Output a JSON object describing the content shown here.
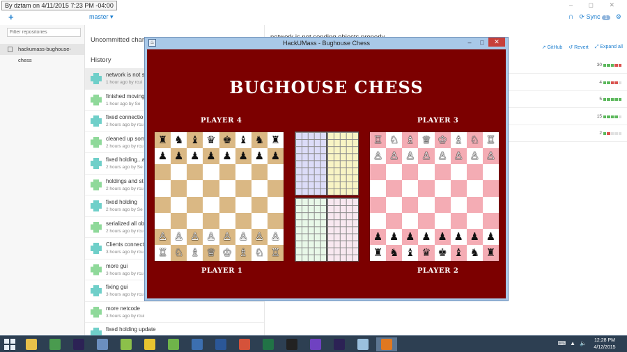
{
  "caption": "By dztam on 4/11/2015 7:23 PM -04:00",
  "github": {
    "add_label": "+",
    "branch": "master ▾",
    "window_controls": "– ◻ ✕",
    "sync_label": "Sync",
    "sync_count": "1",
    "filter_placeholder": "Filter repositories",
    "repo_name": "hackumass-bughouse-chess",
    "uncommitted_label": "Uncommitted changes",
    "history_label": "History",
    "commit_title": "network is not sending objects properly",
    "actions": [
      "GitHub",
      "Revert",
      "Expand all"
    ],
    "commits": [
      {
        "msg": "network is not s",
        "meta": "1 hour ago by rcui"
      },
      {
        "msg": "finished moving",
        "meta": "1 hour ago by Se"
      },
      {
        "msg": "fixed connectio",
        "meta": "2 hours ago by rcu"
      },
      {
        "msg": "cleaned up som",
        "meta": "2 hours ago by rcu"
      },
      {
        "msg": "fixed holding...a",
        "meta": "2 hours ago by Se"
      },
      {
        "msg": "holdings and st",
        "meta": "2 hours ago by rcu"
      },
      {
        "msg": "fixed holding",
        "meta": "2 hours ago by Se"
      },
      {
        "msg": "serialized all ob",
        "meta": "2 hours ago by rcu"
      },
      {
        "msg": "Clients connect",
        "meta": "3 hours ago by rcu"
      },
      {
        "msg": "more gui",
        "meta": "3 hours ago by rcu"
      },
      {
        "msg": "fixing gui",
        "meta": "3 hours ago by rcu"
      },
      {
        "msg": "more netcode",
        "meta": "3 hours ago by rcui"
      },
      {
        "msg": "fixed holding update",
        "meta": ""
      }
    ],
    "files": [
      {
        "count": "30",
        "colors": [
          "#5cb85c",
          "#5cb85c",
          "#5cb85c",
          "#d9534f",
          "#d9534f"
        ]
      },
      {
        "count": "4",
        "colors": [
          "#5cb85c",
          "#5cb85c",
          "#d9534f",
          "#d9534f",
          "#e0e0e0"
        ]
      },
      {
        "count": "5",
        "colors": [
          "#5cb85c",
          "#5cb85c",
          "#5cb85c",
          "#5cb85c",
          "#5cb85c"
        ]
      },
      {
        "count": "15",
        "colors": [
          "#5cb85c",
          "#5cb85c",
          "#5cb85c",
          "#5cb85c",
          "#e0e0e0"
        ]
      },
      {
        "count": "2",
        "colors": [
          "#5cb85c",
          "#d9534f",
          "#e0e0e0",
          "#e0e0e0",
          "#e0e0e0"
        ]
      }
    ]
  },
  "java_window": {
    "title": "HackUMass - Bughouse Chess",
    "minimize": "–",
    "maximize": "□",
    "close": "✕"
  },
  "game": {
    "title": "BUGHOUSE CHESS",
    "players": {
      "p4": "PLAYER 4",
      "p3": "PLAYER 3",
      "p1": "PLAYER 1",
      "p2": "PLAYER 2"
    },
    "boards": [
      {
        "name": "board-left",
        "light": "#ffffff",
        "dark": "#dab884",
        "rows": [
          "♜♞♝♛♚♝♞♜",
          "♟♟♟♟♟♟♟♟",
          "        ",
          "        ",
          "        ",
          "        ",
          "♙♙♙♙♙♙♙♙",
          "♖♘♗♕♔♗♘♖"
        ],
        "row_colors": [
          "b",
          "b",
          "",
          "",
          "",
          "",
          "w",
          "w"
        ]
      },
      {
        "name": "board-right",
        "light": "#ffffff",
        "dark": "#f4acb4",
        "rows": [
          "♖♘♗♕♔♗♘♖",
          "♙♙♙♙♙♙♙♙",
          "        ",
          "        ",
          "        ",
          "        ",
          "♟♟♟♟♟♟♟♟",
          "♜♞♝♛♚♝♞♜"
        ],
        "row_colors": [
          "w",
          "w",
          "",
          "",
          "",
          "",
          "b",
          "b"
        ]
      }
    ],
    "holdings": [
      {
        "name": "holding-top-left",
        "color": "#dcdcf8"
      },
      {
        "name": "holding-top-right",
        "color": "#f8f4c4"
      },
      {
        "name": "holding-bottom-left",
        "color": "#e8f8e8"
      },
      {
        "name": "holding-bottom-right",
        "color": "#f8e8f0"
      }
    ]
  },
  "taskbar": {
    "start_icon": "windows-logo-icon",
    "apps": [
      {
        "name": "file-explorer-icon",
        "color": "#e8c04a"
      },
      {
        "name": "chrome-icon",
        "color": "#4a9b4f"
      },
      {
        "name": "eclipse-icon",
        "color": "#2c2255"
      },
      {
        "name": "network-icon",
        "color": "#6b8fbf"
      },
      {
        "name": "android-icon",
        "color": "#8cc04a"
      },
      {
        "name": "messenger-icon",
        "color": "#e8c430"
      },
      {
        "name": "folder-icon",
        "color": "#6fb44a"
      },
      {
        "name": "virtualbox-icon",
        "color": "#3c6fb0"
      },
      {
        "name": "word-icon",
        "color": "#2b5797"
      },
      {
        "name": "git-icon",
        "color": "#d5523a"
      },
      {
        "name": "excel-icon",
        "color": "#217346"
      },
      {
        "name": "7zip-icon",
        "color": "#222222"
      },
      {
        "name": "github-icon",
        "color": "#6f42c1"
      },
      {
        "name": "eclipse-2-icon",
        "color": "#2c2255"
      },
      {
        "name": "paint-icon",
        "color": "#9bc0de"
      },
      {
        "name": "java-icon",
        "color": "#e07820"
      }
    ],
    "time": "12:28 PM",
    "date": "4/12/2015"
  }
}
